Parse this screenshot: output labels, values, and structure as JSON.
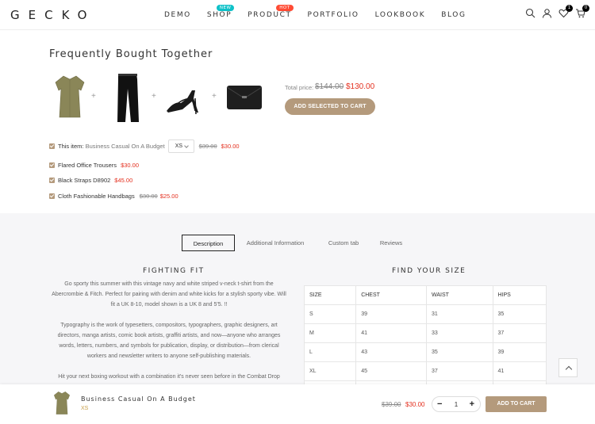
{
  "header": {
    "logo": "GECKO",
    "nav": [
      {
        "label": "DEMO",
        "badge": ""
      },
      {
        "label": "SHOP",
        "badge": "NEW"
      },
      {
        "label": "PRODUCT",
        "badge": "HOT"
      },
      {
        "label": "PORTFOLIO",
        "badge": ""
      },
      {
        "label": "LOOKBOOK",
        "badge": ""
      },
      {
        "label": "BLOG",
        "badge": ""
      }
    ],
    "wishlist_count": "1",
    "cart_count": "0",
    "icons": [
      "search-icon",
      "user-icon",
      "heart-icon",
      "cart-icon"
    ]
  },
  "fbt": {
    "title": "Frequently Bought Together",
    "plus": "+",
    "total_label": "Total price:",
    "total_old": "$144.00",
    "total_new": "$130.00",
    "add_button": "ADD SELECTED TO CART",
    "items": [
      {
        "prefix": "This item:",
        "name": "Business Casual On A Budget",
        "size": "XS",
        "old": "$39.00",
        "new": "$30.00"
      },
      {
        "prefix": "",
        "name": "Flared Office Trousers",
        "size": "",
        "old": "",
        "new": "$30.00"
      },
      {
        "prefix": "",
        "name": "Black Straps D8902",
        "size": "",
        "old": "",
        "new": "$45.00"
      },
      {
        "prefix": "",
        "name": "Cloth Fashionable Handbags",
        "size": "",
        "old": "$30.00",
        "new": "$25.00"
      }
    ]
  },
  "tabs": [
    "Description",
    "Additional Information",
    "Custom tab",
    "Reviews"
  ],
  "description": {
    "heading": "FIGHTING FIT",
    "paragraphs": [
      "Go sporty this summer with this vintage navy and white striped v-neck t-shirt from the Abercrombie & Fitch. Perfect for pairing with denim and white kicks for a stylish sporty vibe. Will fit a UK 8-10, model shown is a UK 8 and 5'5. !!",
      "Typography is the work of typesetters, compositors, typographers, graphic designers, art directors, manga artists, comic book artists, graffiti artists, and now—anyone who arranges words, letters, numbers, and symbols for publication, display, or distribution—from clerical workers and newsletter writers to anyone self-publishing materials.",
      "Hit your next boxing workout with a combination it's never seen before in the Combat Drop"
    ]
  },
  "size_guide": {
    "heading": "FIND YOUR SIZE",
    "columns": [
      "SIZE",
      "CHEST",
      "WAIST",
      "HIPS"
    ],
    "rows": [
      [
        "S",
        "39",
        "31",
        "35"
      ],
      [
        "M",
        "41",
        "33",
        "37"
      ],
      [
        "L",
        "43",
        "35",
        "39"
      ],
      [
        "XL",
        "45",
        "37",
        "41"
      ],
      [
        "",
        "",
        "",
        ""
      ]
    ]
  },
  "sticky": {
    "name": "Business Casual On A Budget",
    "size": "XS",
    "old": "$39.00",
    "new": "$30.00",
    "minus": "−",
    "qty": "1",
    "plus": "+",
    "add_button": "ADD TO CART"
  },
  "colors": {
    "accent": "#b49a7c",
    "sale": "#e4301f",
    "new_badge": "#0ec1c8",
    "hot_badge": "#ff4b34"
  }
}
